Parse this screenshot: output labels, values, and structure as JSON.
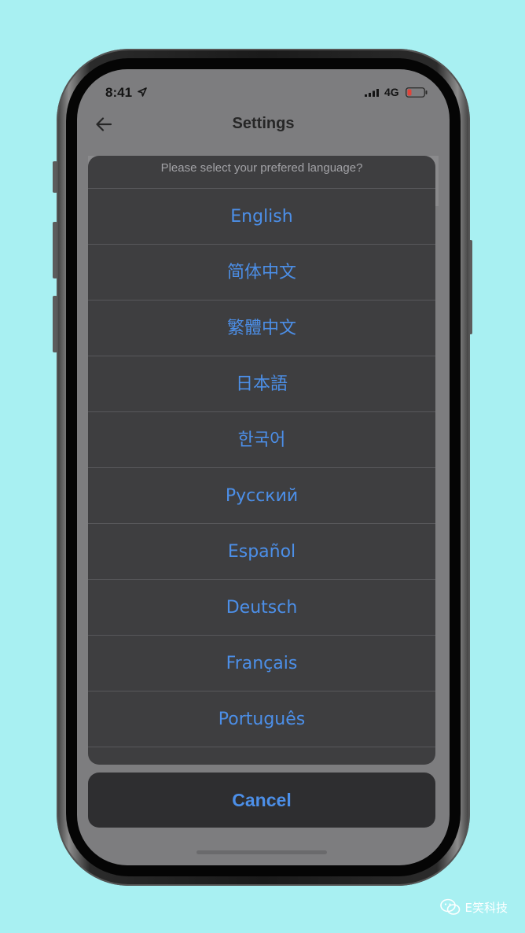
{
  "status_bar": {
    "time": "8:41",
    "network": "4G"
  },
  "header": {
    "title": "Settings"
  },
  "language_sheet": {
    "message": "Please select your prefered language?",
    "options": [
      "English",
      "简体中文",
      "繁體中文",
      "日本語",
      "한국어",
      "Русский",
      "Español",
      "Deutsch",
      "Français",
      "Português"
    ],
    "cancel_label": "Cancel"
  },
  "watermark": {
    "text": "E笑科技"
  },
  "icons": {
    "back": "arrow-left-icon",
    "location": "location-arrow-icon",
    "signal": "cellular-signal-icon",
    "battery": "battery-low-icon",
    "wechat": "wechat-logo-icon"
  },
  "colors": {
    "background": "#a8f0f2",
    "accent": "#4c8fe8",
    "sheet": "#3e3e40",
    "battery_low": "#e0443a"
  }
}
